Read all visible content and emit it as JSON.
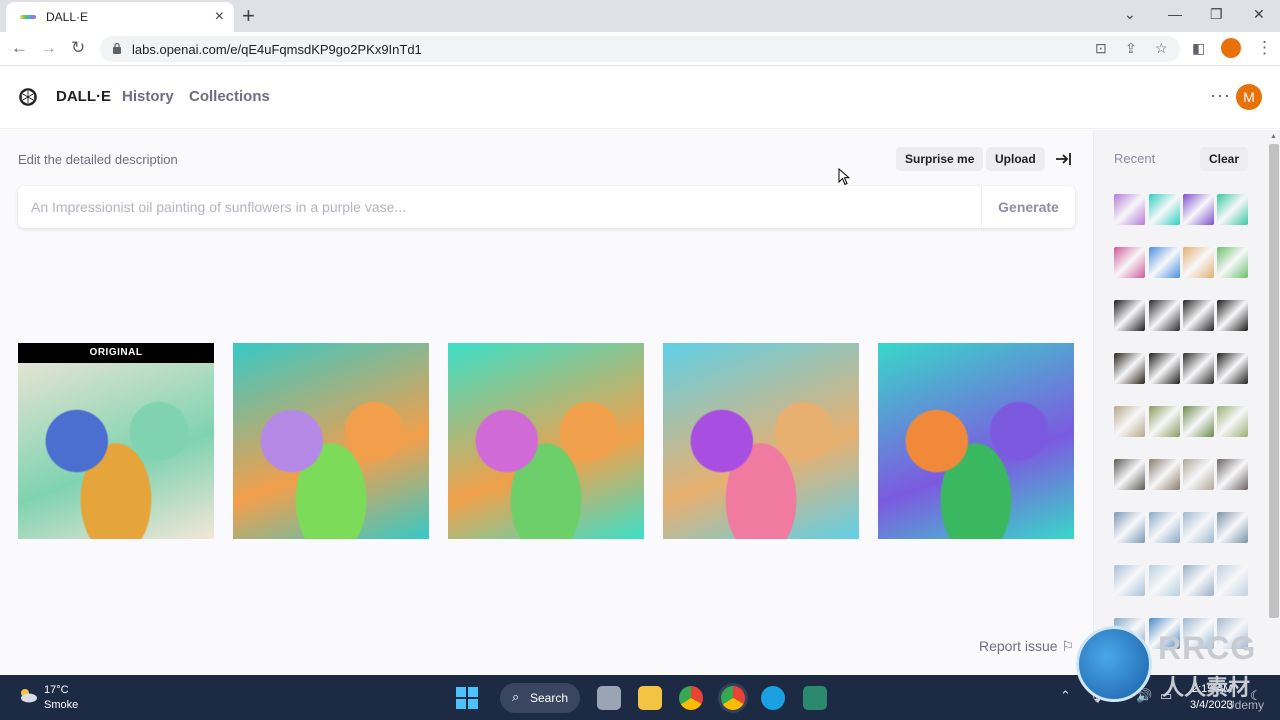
{
  "browser": {
    "tab_title": "DALL·E",
    "url": "labs.openai.com/e/qE4uFqmsdKP9go2PKx9InTd1"
  },
  "app": {
    "brand": "DALL·E",
    "nav": [
      "History",
      "Collections"
    ],
    "avatar_initial": "M"
  },
  "editor": {
    "label": "Edit the detailed description",
    "surprise_label": "Surprise me",
    "upload_label": "Upload",
    "placeholder": "An Impressionist oil painting of sunflowers in a purple vase...",
    "generate_label": "Generate"
  },
  "gallery": {
    "original_badge": "ORIGINAL",
    "images": [
      {
        "label": "original cell illustration",
        "colors": [
          "#f3e6d8",
          "#4a6fd0",
          "#7fd3b0",
          "#e5a53a"
        ]
      },
      {
        "label": "variation 1 cell illustration",
        "colors": [
          "#36c9c6",
          "#b48ae6",
          "#f29f4c",
          "#7cdc5a"
        ]
      },
      {
        "label": "variation 2 cell illustration",
        "colors": [
          "#3ce0c8",
          "#d06ad6",
          "#f0a04a",
          "#6ccf6a"
        ]
      },
      {
        "label": "variation 3 cell illustration",
        "colors": [
          "#5fd0e8",
          "#a84ee0",
          "#e8b070",
          "#f07aa0"
        ]
      },
      {
        "label": "variation 4 cell illustration",
        "colors": [
          "#38d8c8",
          "#f08a3a",
          "#7c5ae0",
          "#3ab860"
        ]
      }
    ],
    "report_label": "Report issue"
  },
  "sidebar": {
    "recent_label": "Recent",
    "clear_label": "Clear",
    "thumb_rows": [
      [
        "#b47ad8",
        "#2fcfbf",
        "#7c4ed0",
        "#36c9a0"
      ],
      [
        "#d05a9a",
        "#4a8ee0",
        "#e0b070",
        "#6abf6a"
      ],
      [
        "#1c1c1c",
        "#2a2a2a",
        "#242424",
        "#1a1a1a"
      ],
      [
        "#2a2218",
        "#1e1e1e",
        "#2c2c2c",
        "#202020"
      ],
      [
        "#b8a68a",
        "#8a9a5a",
        "#6a8a4a",
        "#9ab070"
      ],
      [
        "#5a5a52",
        "#8a7a6a",
        "#b0a898",
        "#6a6260"
      ],
      [
        "#7a98b8",
        "#8aa8c8",
        "#9ab8d0",
        "#7890a8"
      ],
      [
        "#a8c0d8",
        "#b8d0e0",
        "#98b0c8",
        "#c0d0e0"
      ],
      [
        "#88a8c8",
        "#4a88c8",
        "#9ab8d0",
        "#a0b8d0"
      ]
    ]
  },
  "taskbar": {
    "temperature": "17°C",
    "condition": "Smoke",
    "search_label": "Search",
    "time": "2:19 AM",
    "date": "3/4/2023"
  },
  "watermark": {
    "title": "RRCG",
    "subtitle": "人人素材",
    "udemy": "Udemy"
  }
}
